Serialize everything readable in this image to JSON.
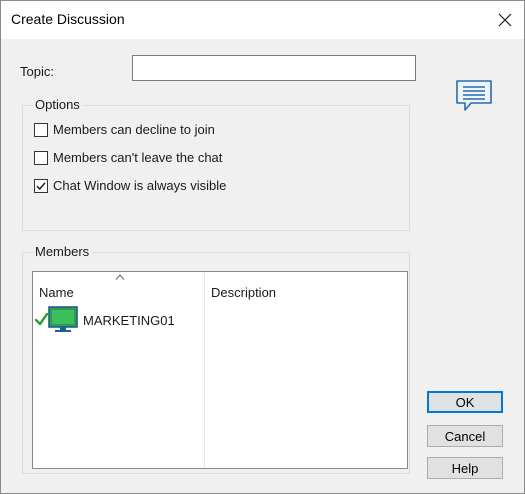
{
  "window": {
    "title": "Create Discussion",
    "close_glyph": "✕"
  },
  "topic": {
    "label": "Topic:",
    "value": ""
  },
  "chat_icon": "chat-bubble-icon",
  "options": {
    "title": "Options",
    "checkboxes": [
      {
        "label": "Members can decline to join",
        "checked": false
      },
      {
        "label": "Members can't leave the chat",
        "checked": false
      },
      {
        "label": "Chat Window is always visible",
        "checked": true
      }
    ]
  },
  "members": {
    "title": "Members",
    "columns": [
      {
        "label": "Name",
        "sorted": true
      },
      {
        "label": "Description",
        "sorted": false
      }
    ],
    "rows": [
      {
        "name": "MARKETING01",
        "description": "",
        "status": "connected",
        "status_color": "#2e9e2e",
        "icon": "computer-icon"
      }
    ]
  },
  "buttons": {
    "ok": "OK",
    "cancel": "Cancel",
    "help": "Help"
  },
  "colors": {
    "accent": "#0078d7",
    "dialog_bg": "#f0f0f0",
    "monitor": "#2aa04a",
    "bubble": "#2b6aa8"
  }
}
